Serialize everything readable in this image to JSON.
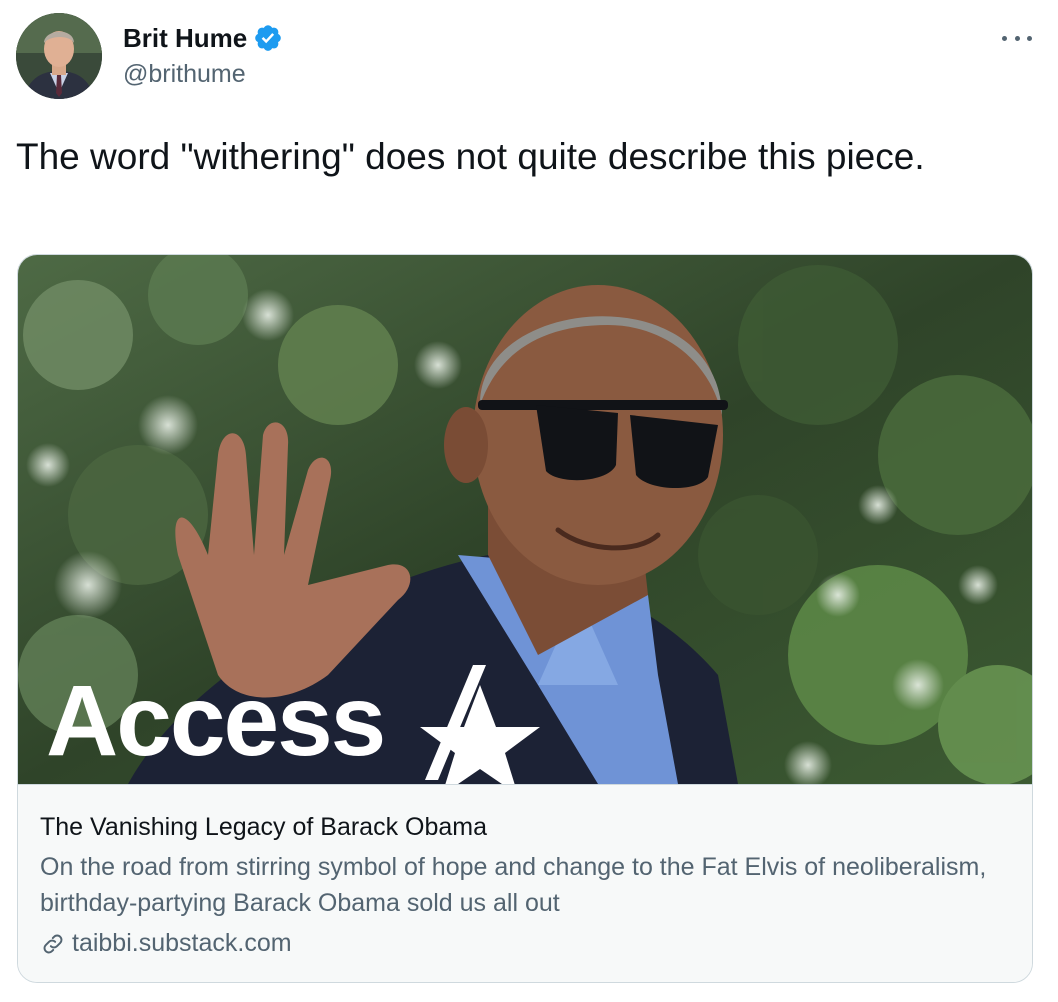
{
  "author": {
    "display_name": "Brit Hume",
    "handle": "@brithume",
    "verified_icon": "verified-badge-icon",
    "accent_color": "#1d9bf0"
  },
  "menu": {
    "icon": "more-options-icon"
  },
  "tweet": {
    "text": "The word \"withering\" does not quite describe this piece."
  },
  "card": {
    "image_overlay_text": "Access",
    "title": "The Vanishing Legacy of Barack Obama",
    "description": "On the road from stirring symbol of hope and change to the Fat Elvis of neoliberalism, birthday-partying Barack Obama sold us all out",
    "domain": "taibbi.substack.com",
    "domain_icon": "link-icon"
  }
}
